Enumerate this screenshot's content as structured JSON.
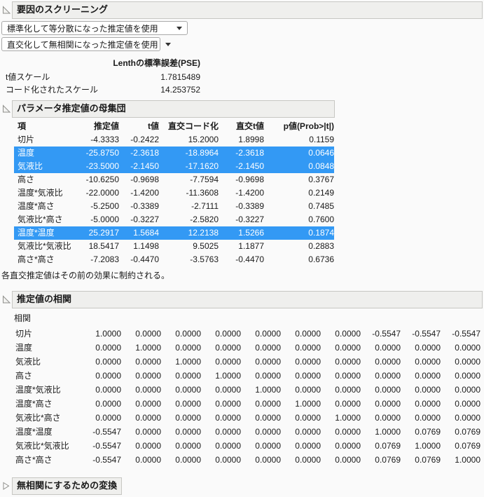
{
  "colors": {
    "highlight": "#3399f4",
    "header_bg": "#efefed",
    "header_border": "#c7c7c3"
  },
  "root": {
    "title": "要因のスクリーニング"
  },
  "dropdowns": [
    {
      "label": "標準化して等分散になった推定値を使用"
    },
    {
      "label": "直交化して無相関になった推定値を使用"
    }
  ],
  "pse": {
    "header": "Lenthの標準誤差(PSE)",
    "rows": [
      {
        "label": "t値スケール",
        "value": "1.7815489"
      },
      {
        "label": "コード化されたスケール",
        "value": "14.253752"
      }
    ]
  },
  "param_section": {
    "title": "パラメータ推定値の母集団",
    "columns": [
      "項",
      "推定値",
      "t値",
      "直交コード化",
      "直交t値",
      "p値(Prob>|t|)"
    ],
    "rows": [
      {
        "term": "切片",
        "estimate": "-4.3333",
        "t": "-0.2422",
        "ortho": "15.2000",
        "ortho_t": "1.8998",
        "p": "0.1159",
        "highlight": false
      },
      {
        "term": "温度",
        "estimate": "-25.8750",
        "t": "-2.3618",
        "ortho": "-18.8964",
        "ortho_t": "-2.3618",
        "p": "0.0646",
        "highlight": true
      },
      {
        "term": "気液比",
        "estimate": "-23.5000",
        "t": "-2.1450",
        "ortho": "-17.1620",
        "ortho_t": "-2.1450",
        "p": "0.0848",
        "highlight": true
      },
      {
        "term": "高さ",
        "estimate": "-10.6250",
        "t": "-0.9698",
        "ortho": "-7.7594",
        "ortho_t": "-0.9698",
        "p": "0.3767",
        "highlight": false
      },
      {
        "term": "温度*気液比",
        "estimate": "-22.0000",
        "t": "-1.4200",
        "ortho": "-11.3608",
        "ortho_t": "-1.4200",
        "p": "0.2149",
        "highlight": false
      },
      {
        "term": "温度*高さ",
        "estimate": "-5.2500",
        "t": "-0.3389",
        "ortho": "-2.7111",
        "ortho_t": "-0.3389",
        "p": "0.7485",
        "highlight": false
      },
      {
        "term": "気液比*高さ",
        "estimate": "-5.0000",
        "t": "-0.3227",
        "ortho": "-2.5820",
        "ortho_t": "-0.3227",
        "p": "0.7600",
        "highlight": false
      },
      {
        "term": "温度*温度",
        "estimate": "25.2917",
        "t": "1.5684",
        "ortho": "12.2138",
        "ortho_t": "1.5266",
        "p": "0.1874",
        "highlight": true
      },
      {
        "term": "気液比*気液比",
        "estimate": "18.5417",
        "t": "1.1498",
        "ortho": "9.5025",
        "ortho_t": "1.1877",
        "p": "0.2883",
        "highlight": false
      },
      {
        "term": "高さ*高さ",
        "estimate": "-7.2083",
        "t": "-0.4470",
        "ortho": "-3.5763",
        "ortho_t": "-0.4470",
        "p": "0.6736",
        "highlight": false
      }
    ],
    "note": "各直交推定値はその前の効果に制約される。"
  },
  "correlation_section": {
    "title": "推定値の相関",
    "subtitle": "相関",
    "rows": [
      {
        "term": "切片",
        "values": [
          "1.0000",
          "0.0000",
          "0.0000",
          "0.0000",
          "0.0000",
          "0.0000",
          "0.0000",
          "-0.5547",
          "-0.5547",
          "-0.5547"
        ]
      },
      {
        "term": "温度",
        "values": [
          "0.0000",
          "1.0000",
          "0.0000",
          "0.0000",
          "0.0000",
          "0.0000",
          "0.0000",
          "0.0000",
          "0.0000",
          "0.0000"
        ]
      },
      {
        "term": "気液比",
        "values": [
          "0.0000",
          "0.0000",
          "1.0000",
          "0.0000",
          "0.0000",
          "0.0000",
          "0.0000",
          "0.0000",
          "0.0000",
          "0.0000"
        ]
      },
      {
        "term": "高さ",
        "values": [
          "0.0000",
          "0.0000",
          "0.0000",
          "1.0000",
          "0.0000",
          "0.0000",
          "0.0000",
          "0.0000",
          "0.0000",
          "0.0000"
        ]
      },
      {
        "term": "温度*気液比",
        "values": [
          "0.0000",
          "0.0000",
          "0.0000",
          "0.0000",
          "1.0000",
          "0.0000",
          "0.0000",
          "0.0000",
          "0.0000",
          "0.0000"
        ]
      },
      {
        "term": "温度*高さ",
        "values": [
          "0.0000",
          "0.0000",
          "0.0000",
          "0.0000",
          "0.0000",
          "1.0000",
          "0.0000",
          "0.0000",
          "0.0000",
          "0.0000"
        ]
      },
      {
        "term": "気液比*高さ",
        "values": [
          "0.0000",
          "0.0000",
          "0.0000",
          "0.0000",
          "0.0000",
          "0.0000",
          "1.0000",
          "0.0000",
          "0.0000",
          "0.0000"
        ]
      },
      {
        "term": "温度*温度",
        "values": [
          "-0.5547",
          "0.0000",
          "0.0000",
          "0.0000",
          "0.0000",
          "0.0000",
          "0.0000",
          "1.0000",
          "0.0769",
          "0.0769"
        ]
      },
      {
        "term": "気液比*気液比",
        "values": [
          "-0.5547",
          "0.0000",
          "0.0000",
          "0.0000",
          "0.0000",
          "0.0000",
          "0.0000",
          "0.0769",
          "1.0000",
          "0.0769"
        ]
      },
      {
        "term": "高さ*高さ",
        "values": [
          "-0.5547",
          "0.0000",
          "0.0000",
          "0.0000",
          "0.0000",
          "0.0000",
          "0.0000",
          "0.0769",
          "0.0769",
          "1.0000"
        ]
      }
    ]
  },
  "collapsed_section": {
    "title": "無相関にするための変換"
  }
}
